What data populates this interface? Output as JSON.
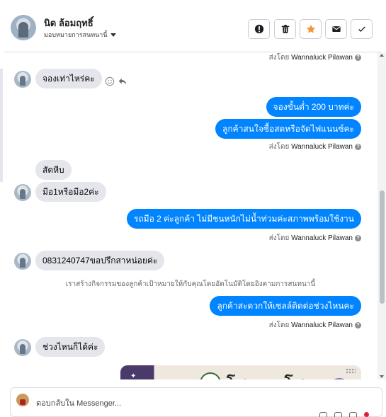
{
  "header": {
    "name": "นิด ล้อมฤทธิ์",
    "subtitle": "มอบหมายการสนทนานี้",
    "actions": [
      "report-icon",
      "trash-icon",
      "star-icon",
      "mail-icon",
      "check-icon"
    ],
    "star_color": "#f7923b"
  },
  "composer": {
    "placeholder": "ตอบกลับใน Messenger..."
  },
  "sender_label": "ส่งโดย",
  "sender_name": "Wannaluck Pilawan",
  "messages": {
    "m1": "จองเท่าไหร่คะ",
    "m2": "จองขั้นต่ำ 200 บาทค่ะ",
    "m3": "ลูกค้าสนใจซื้อสดหรือจัดไฟแนนซ์คะ",
    "m4": "สัดหีบ",
    "m5": "มือ1หรือมือ2ค่ะ",
    "m6": "รถมือ 2 ค่ะลูกค้า  ไม่มีชนหนักไม่น้ำท่วมค่ะสภาพพร้อมใช้งาน",
    "m7": "0831240747ขอปรึกสาหน่อยค่ะ",
    "m8": "เราสร้างกิจกรรมของลูกค้าเป้าหมายให้กับคุณโดยอัตโนมัติโดยอิงตามการสนทนานี้",
    "m9": "ลูกค้าสะดวกให้เซลล์ติดต่อช่วงไหนคะ",
    "m10": "ช่วงไหนก็ได้ค่ะ",
    "card_title": "โชคคูณโชค"
  },
  "colors": {
    "outgoing_bubble": "#0084ff",
    "incoming_bubble": "#e4e6eb"
  }
}
